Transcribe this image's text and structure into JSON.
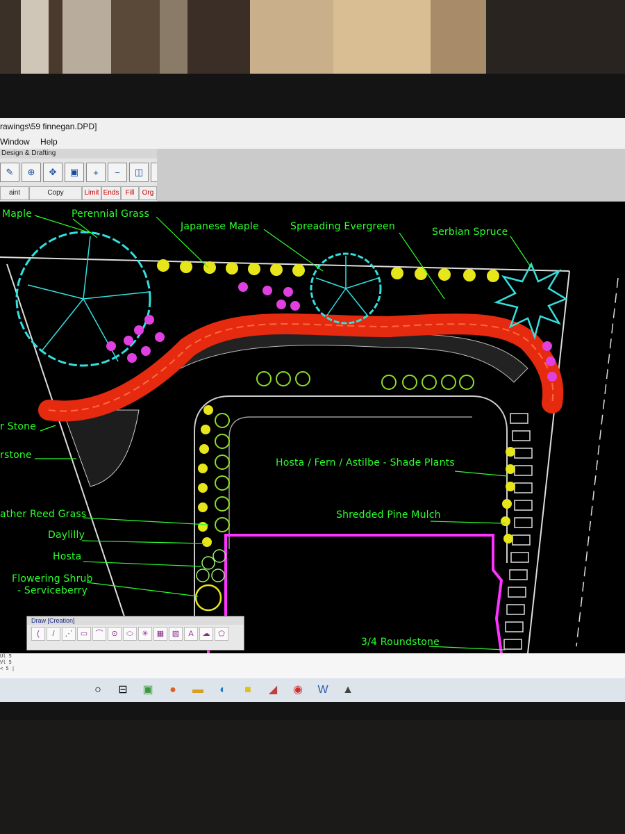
{
  "window": {
    "title": "rawings\\59 finnegan.DPD]"
  },
  "menu": {
    "items": [
      "Window",
      "Help"
    ]
  },
  "toolpanel": {
    "title": "Design & Drafting",
    "labels": {
      "paint": "aint",
      "copy": "Copy",
      "limit": "Limit",
      "ends": "Ends",
      "fill": "Fill",
      "org": "Org"
    }
  },
  "plan_labels": {
    "maple": "Maple",
    "perennial_grass": "Perennial Grass",
    "japanese_maple": "Japanese Maple",
    "spreading_evergreen": "Spreading Evergreen",
    "serbian_spruce": "Serbian Spruce",
    "stone1": "r Stone",
    "stone2": "rstone",
    "hosta_fern": "Hosta / Fern / Astilbe - Shade Plants",
    "shredded_mulch": "Shredded Pine Mulch",
    "feather_reed": "ather Reed Grass",
    "daylily": "Daylilly",
    "hosta": "Hosta",
    "flowering_shrub_1": "Flowering Shrub",
    "flowering_shrub_2": "- Serviceberry",
    "roundstone": "3/4 Roundstone"
  },
  "draw_toolbar": {
    "title": "Draw [Creation]"
  },
  "command_lines": [
    "Ul 5",
    "Vl 5",
    "< 5 |"
  ],
  "taskbar": {
    "icons": [
      "start-circle-icon",
      "task-view-icon",
      "app-icon",
      "firefox-icon",
      "folder-icon",
      "edge-icon",
      "notes-icon",
      "app2-icon",
      "chrome-icon",
      "word-icon",
      "image-icon"
    ]
  },
  "colors": {
    "cad_text": "#2cff2c",
    "tree_outline": "#33e0e0",
    "mulch_red": "#e52a10",
    "house_magenta": "#ff33ff",
    "shrub_yellow": "#e6e61a"
  }
}
